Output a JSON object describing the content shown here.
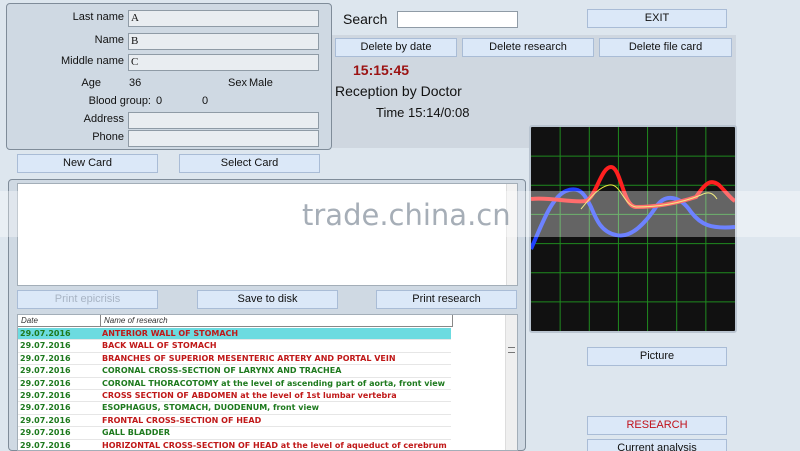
{
  "patient": {
    "last_name_label": "Last name",
    "last_name": "A",
    "name_label": "Name",
    "name": "B",
    "middle_name_label": "Middle name",
    "middle_name": "C",
    "age_label": "Age",
    "age": "36",
    "sex_label": "Sex",
    "sex": "Male",
    "blood_group_label": "Blood group:",
    "blood_group_a": "0",
    "blood_group_b": "0",
    "address_label": "Address",
    "address": "",
    "phone_label": "Phone",
    "phone": ""
  },
  "search": {
    "label": "Search",
    "value": ""
  },
  "toolbar": {
    "exit": "EXIT",
    "delete_by_date": "Delete by date",
    "delete_research": "Delete research",
    "delete_file_card": "Delete file card"
  },
  "status": {
    "clock": "15:15:45",
    "reception": "Reception by Doctor",
    "time": "Time 15:14/0:08"
  },
  "card_buttons": {
    "new_card": "New Card",
    "select_card": "Select Card"
  },
  "actions": {
    "print_epicrisis": "Print epicrisis",
    "save_to_disk": "Save to disk",
    "print_research": "Print research"
  },
  "research_list": {
    "col_date": "Date",
    "col_name": "Name of research",
    "rows": [
      {
        "date": "29.07.2016",
        "name": "ANTERIOR  WALL  OF  STOMACH",
        "color": "red",
        "selected": true
      },
      {
        "date": "29.07.2016",
        "name": "BACK WALL OF STOMACH",
        "color": "red",
        "selected": false
      },
      {
        "date": "29.07.2016",
        "name": "BRANCHES OF SUPERIOR MESENTERIC ARTERY AND PORTAL VEIN",
        "color": "red",
        "selected": false
      },
      {
        "date": "29.07.2016",
        "name": "CORONAL CROSS-SECTION OF LARYNX AND TRACHEA",
        "color": "green",
        "selected": false
      },
      {
        "date": "29.07.2016",
        "name": "CORONAL THORACOTOMY at the level of ascending part of aorta, front view",
        "color": "green",
        "selected": false
      },
      {
        "date": "29.07.2016",
        "name": "CROSS SECTION OF ABDOMEN at the level of 1st lumbar vertebra",
        "color": "red",
        "selected": false
      },
      {
        "date": "29.07.2016",
        "name": "ESOPHAGUS,  STOMACH,  DUODENUM,  front  view",
        "color": "green",
        "selected": false
      },
      {
        "date": "29.07.2016",
        "name": "FRONTAL CROSS-SECTION OF HEAD",
        "color": "red",
        "selected": false
      },
      {
        "date": "29.07.2016",
        "name": "GALL  BLADDER",
        "color": "green",
        "selected": false
      },
      {
        "date": "29.07.2016",
        "name": "HORIZONTAL CROSS-SECTION OF HEAD at the level of aqueduct of cerebrum",
        "color": "red",
        "selected": false
      }
    ]
  },
  "right_panel": {
    "picture": "Picture",
    "research": "RESEARCH",
    "current_analysis": "Current analysis"
  },
  "watermark": "trade.china.cn",
  "colors": {
    "accent_red": "#c01818",
    "text_green": "#1e7a1e",
    "selection": "#6cdbe0",
    "graph_bg": "#111111",
    "grid": "#1f8a1f",
    "signal_red": "#ff2020",
    "signal_blue": "#2040ff",
    "signal_yellow": "#e8e040"
  }
}
